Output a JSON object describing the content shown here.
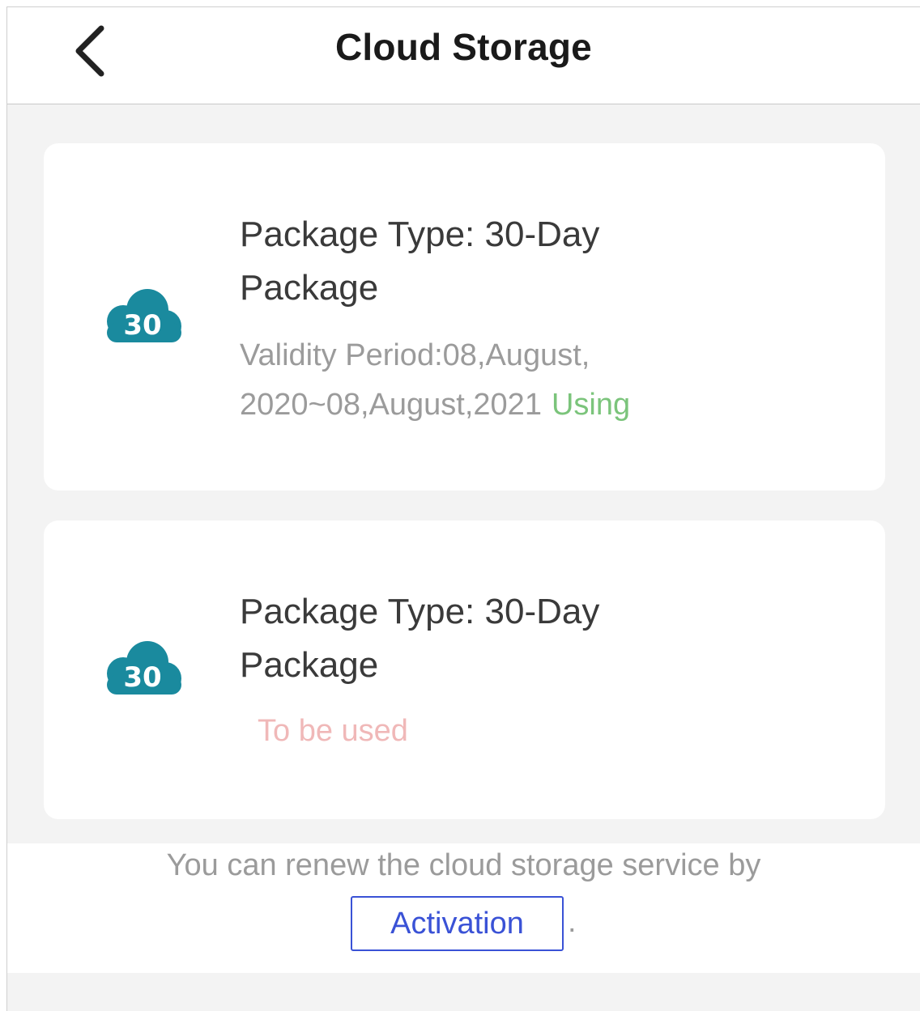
{
  "header": {
    "title": "Cloud Storage",
    "back_icon": "chevron-left-icon"
  },
  "packages": [
    {
      "badge": "30",
      "icon": "cloud-icon",
      "type_label": "Package Type: 30-Day Package",
      "validity": "Validity Period:08,August, 2020~08,August,2021",
      "status": "Using",
      "status_color": "#7bc47b"
    },
    {
      "badge": "30",
      "icon": "cloud-icon",
      "type_label": "Package Type: 30-Day Package",
      "status": "To be used",
      "status_color": "#f0b8b8"
    }
  ],
  "footer": {
    "text": "You can renew the cloud storage service by",
    "activation_label": "Activation",
    "trailing": "."
  },
  "colors": {
    "accent": "#3a52d6",
    "cloud": "#1a8a9e"
  }
}
